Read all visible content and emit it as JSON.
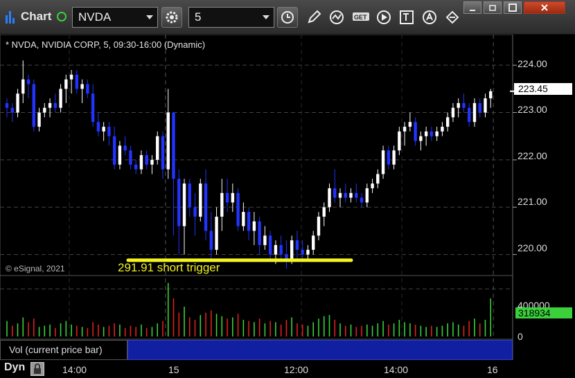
{
  "toolbar": {
    "title": "Chart",
    "symbol": "NVDA",
    "interval": "5",
    "icons": [
      "gear-icon",
      "clock-icon",
      "pencil-icon",
      "study-icon",
      "get-icon",
      "play-icon",
      "text-icon",
      "alert-icon",
      "link-icon"
    ]
  },
  "window": {
    "controls": [
      "minimize",
      "restore",
      "maximize",
      "close"
    ]
  },
  "chart": {
    "symbol_title": "* NVDA, NVIDIA CORP, 5, 09:30-16:00 (Dynamic)",
    "copyright": "© eSignal, 2021",
    "annotation": "291.91 short trigger",
    "price_labels": [
      "224.00",
      "223.00",
      "222.00",
      "221.00",
      "220.00"
    ],
    "current_price": "223.45",
    "volume_labels": [
      "400000",
      "0"
    ],
    "current_volume": "318934",
    "time_labels": [
      "14:00",
      "15",
      "12:00",
      "14:00",
      "16"
    ],
    "volume_study_label": "Vol (current price bar)",
    "bottom_label": "Dyn",
    "colors": {
      "up": "#ffffff",
      "down": "#2233ff",
      "vol_up": "#3ad13a",
      "vol_down": "#e02020",
      "trigger": "#f5f520",
      "current_price": "#ffffff",
      "current_volume": "#3ad13a"
    }
  },
  "chart_data": {
    "type": "candlestick",
    "title": "",
    "price_range": [
      219.6,
      224.5
    ],
    "volume_range": [
      0,
      500000
    ],
    "trigger_level": 219.88,
    "session_breaks": [
      "15",
      "16"
    ],
    "candles": [
      [
        223.2,
        223.3,
        222.9,
        223.1
      ],
      [
        223.1,
        223.2,
        222.8,
        223.0
      ],
      [
        223.0,
        223.5,
        222.9,
        223.4
      ],
      [
        223.4,
        224.1,
        223.2,
        223.7
      ],
      [
        223.7,
        223.8,
        223.3,
        223.6
      ],
      [
        223.6,
        223.7,
        222.6,
        222.7
      ],
      [
        222.7,
        223.1,
        222.6,
        223.0
      ],
      [
        223.0,
        223.2,
        222.9,
        223.1
      ],
      [
        223.1,
        223.3,
        222.9,
        223.2
      ],
      [
        223.2,
        223.4,
        223.0,
        223.1
      ],
      [
        223.1,
        223.6,
        223.0,
        223.5
      ],
      [
        223.5,
        223.8,
        223.2,
        223.7
      ],
      [
        223.7,
        223.9,
        223.4,
        223.8
      ],
      [
        223.8,
        223.9,
        223.4,
        223.5
      ],
      [
        223.5,
        223.7,
        223.2,
        223.6
      ],
      [
        223.6,
        223.7,
        223.3,
        223.4
      ],
      [
        223.4,
        223.6,
        222.7,
        222.8
      ],
      [
        222.8,
        223.0,
        222.5,
        222.6
      ],
      [
        222.6,
        222.8,
        222.4,
        222.7
      ],
      [
        222.7,
        222.8,
        222.3,
        222.5
      ],
      [
        222.5,
        222.7,
        221.8,
        221.9
      ],
      [
        221.9,
        222.4,
        221.8,
        222.3
      ],
      [
        222.3,
        222.5,
        222.1,
        222.2
      ],
      [
        222.2,
        222.3,
        221.8,
        221.9
      ],
      [
        221.9,
        222.0,
        221.7,
        221.8
      ],
      [
        221.8,
        222.2,
        221.7,
        222.1
      ],
      [
        222.1,
        222.2,
        221.8,
        221.9
      ],
      [
        221.9,
        222.1,
        221.7,
        222.0
      ],
      [
        222.0,
        222.6,
        221.9,
        222.5
      ],
      [
        222.5,
        222.6,
        221.6,
        221.8
      ],
      [
        221.8,
        223.5,
        221.6,
        223.0
      ],
      [
        223.0,
        223.0,
        220.4,
        221.6
      ],
      [
        221.6,
        221.8,
        220.0,
        220.6
      ],
      [
        220.6,
        221.6,
        220.0,
        221.5
      ],
      [
        221.5,
        221.6,
        220.8,
        221.0
      ],
      [
        221.0,
        221.3,
        220.4,
        220.8
      ],
      [
        220.8,
        221.6,
        220.7,
        221.5
      ],
      [
        221.5,
        221.8,
        220.3,
        220.5
      ],
      [
        220.5,
        220.9,
        219.9,
        220.1
      ],
      [
        220.1,
        221.0,
        220.0,
        220.8
      ],
      [
        220.8,
        221.6,
        220.5,
        221.3
      ],
      [
        221.3,
        221.6,
        220.9,
        221.1
      ],
      [
        221.1,
        221.5,
        220.9,
        221.3
      ],
      [
        221.3,
        221.4,
        220.5,
        220.6
      ],
      [
        220.6,
        221.1,
        220.5,
        220.9
      ],
      [
        220.9,
        221.0,
        220.3,
        220.5
      ],
      [
        220.5,
        220.9,
        220.2,
        220.7
      ],
      [
        220.7,
        220.8,
        220.0,
        220.2
      ],
      [
        220.2,
        220.6,
        220.1,
        220.4
      ],
      [
        220.4,
        220.5,
        219.9,
        220.0
      ],
      [
        220.0,
        220.3,
        219.8,
        220.2
      ],
      [
        220.2,
        220.4,
        219.9,
        220.0
      ],
      [
        220.0,
        220.3,
        219.7,
        219.9
      ],
      [
        219.9,
        220.4,
        219.8,
        220.3
      ],
      [
        220.3,
        220.5,
        219.9,
        220.1
      ],
      [
        220.1,
        220.3,
        219.9,
        220.0
      ],
      [
        220.0,
        220.2,
        219.9,
        220.1
      ],
      [
        220.1,
        220.5,
        220.0,
        220.4
      ],
      [
        220.4,
        220.9,
        220.3,
        220.8
      ],
      [
        220.8,
        221.1,
        220.6,
        221.0
      ],
      [
        221.0,
        221.5,
        220.9,
        221.4
      ],
      [
        221.4,
        221.8,
        221.1,
        221.2
      ],
      [
        221.2,
        221.4,
        221.0,
        221.3
      ],
      [
        221.3,
        221.5,
        221.1,
        221.2
      ],
      [
        221.2,
        221.4,
        221.1,
        221.3
      ],
      [
        221.3,
        221.5,
        221.1,
        221.2
      ],
      [
        221.2,
        221.3,
        221.0,
        221.1
      ],
      [
        221.1,
        221.5,
        221.0,
        221.4
      ],
      [
        221.4,
        221.6,
        221.3,
        221.5
      ],
      [
        221.5,
        221.8,
        221.4,
        221.7
      ],
      [
        221.7,
        222.3,
        221.6,
        222.2
      ],
      [
        222.2,
        222.3,
        221.8,
        221.9
      ],
      [
        221.9,
        222.3,
        221.8,
        222.2
      ],
      [
        222.2,
        222.7,
        222.1,
        222.6
      ],
      [
        222.6,
        222.8,
        222.3,
        222.7
      ],
      [
        222.7,
        223.0,
        222.6,
        222.8
      ],
      [
        222.8,
        222.9,
        222.3,
        222.4
      ],
      [
        222.4,
        222.6,
        222.2,
        222.5
      ],
      [
        222.5,
        222.7,
        222.3,
        222.6
      ],
      [
        222.6,
        222.7,
        222.4,
        222.5
      ],
      [
        222.5,
        222.7,
        222.4,
        222.6
      ],
      [
        222.6,
        222.8,
        222.5,
        222.7
      ],
      [
        222.7,
        223.0,
        222.6,
        222.9
      ],
      [
        222.9,
        223.2,
        222.8,
        223.1
      ],
      [
        223.1,
        223.3,
        222.9,
        223.2
      ],
      [
        223.2,
        223.4,
        223.0,
        223.1
      ],
      [
        223.1,
        223.2,
        222.7,
        222.8
      ],
      [
        222.8,
        223.3,
        222.7,
        223.2
      ],
      [
        223.2,
        223.3,
        222.9,
        223.0
      ],
      [
        223.0,
        223.4,
        222.9,
        223.3
      ],
      [
        223.3,
        223.5,
        223.1,
        223.45
      ]
    ],
    "volumes": [
      [
        130000,
        1
      ],
      [
        90000,
        0
      ],
      [
        110000,
        1
      ],
      [
        160000,
        1
      ],
      [
        120000,
        0
      ],
      [
        150000,
        0
      ],
      [
        80000,
        1
      ],
      [
        90000,
        1
      ],
      [
        100000,
        1
      ],
      [
        70000,
        0
      ],
      [
        110000,
        1
      ],
      [
        130000,
        1
      ],
      [
        100000,
        1
      ],
      [
        90000,
        0
      ],
      [
        80000,
        1
      ],
      [
        70000,
        0
      ],
      [
        120000,
        0
      ],
      [
        100000,
        0
      ],
      [
        80000,
        1
      ],
      [
        90000,
        0
      ],
      [
        110000,
        0
      ],
      [
        100000,
        1
      ],
      [
        70000,
        0
      ],
      [
        90000,
        0
      ],
      [
        80000,
        0
      ],
      [
        100000,
        1
      ],
      [
        70000,
        0
      ],
      [
        80000,
        1
      ],
      [
        110000,
        1
      ],
      [
        130000,
        0
      ],
      [
        450000,
        1
      ],
      [
        320000,
        0
      ],
      [
        200000,
        0
      ],
      [
        250000,
        1
      ],
      [
        160000,
        0
      ],
      [
        140000,
        0
      ],
      [
        180000,
        1
      ],
      [
        200000,
        0
      ],
      [
        220000,
        0
      ],
      [
        190000,
        1
      ],
      [
        170000,
        1
      ],
      [
        150000,
        0
      ],
      [
        160000,
        1
      ],
      [
        190000,
        0
      ],
      [
        140000,
        1
      ],
      [
        130000,
        0
      ],
      [
        120000,
        1
      ],
      [
        150000,
        0
      ],
      [
        110000,
        1
      ],
      [
        130000,
        0
      ],
      [
        120000,
        1
      ],
      [
        100000,
        0
      ],
      [
        140000,
        0
      ],
      [
        160000,
        1
      ],
      [
        110000,
        0
      ],
      [
        100000,
        0
      ],
      [
        90000,
        1
      ],
      [
        120000,
        1
      ],
      [
        150000,
        1
      ],
      [
        170000,
        1
      ],
      [
        180000,
        1
      ],
      [
        140000,
        0
      ],
      [
        110000,
        1
      ],
      [
        90000,
        0
      ],
      [
        100000,
        1
      ],
      [
        80000,
        0
      ],
      [
        90000,
        0
      ],
      [
        100000,
        1
      ],
      [
        90000,
        1
      ],
      [
        110000,
        1
      ],
      [
        130000,
        1
      ],
      [
        100000,
        0
      ],
      [
        110000,
        1
      ],
      [
        140000,
        1
      ],
      [
        120000,
        1
      ],
      [
        110000,
        1
      ],
      [
        100000,
        0
      ],
      [
        90000,
        1
      ],
      [
        80000,
        1
      ],
      [
        90000,
        0
      ],
      [
        80000,
        1
      ],
      [
        90000,
        1
      ],
      [
        110000,
        1
      ],
      [
        120000,
        1
      ],
      [
        100000,
        1
      ],
      [
        90000,
        0
      ],
      [
        130000,
        0
      ],
      [
        150000,
        1
      ],
      [
        110000,
        0
      ],
      [
        140000,
        1
      ],
      [
        318934,
        1
      ]
    ]
  }
}
